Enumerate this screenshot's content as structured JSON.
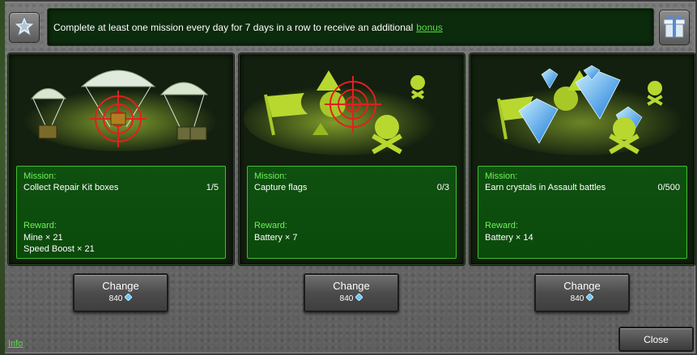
{
  "header": {
    "message": "Complete at least one mission every day for 7 days in a row to receive an additional",
    "bonus_link": "bonus",
    "star_icon": "star-icon",
    "gift_icon": "gift-icon"
  },
  "missions": [
    {
      "mission_label": "Mission:",
      "task": "Collect Repair Kit boxes",
      "progress": "1/5",
      "reward_label": "Reward:",
      "rewards": [
        "Mine × 21",
        "Speed Boost × 21"
      ],
      "change_label": "Change",
      "price": "840",
      "art_icon": "parachute-crates-target-icon"
    },
    {
      "mission_label": "Mission:",
      "task": "Capture flags",
      "progress": "0/3",
      "reward_label": "Reward:",
      "rewards": [
        "Battery × 7"
      ],
      "change_label": "Change",
      "price": "840",
      "art_icon": "flag-target-skull-icon"
    },
    {
      "mission_label": "Mission:",
      "task": "Earn crystals in Assault battles",
      "progress": "0/500",
      "reward_label": "Reward:",
      "rewards": [
        "Battery × 14"
      ],
      "change_label": "Change",
      "price": "840",
      "art_icon": "crystals-flag-skull-icon"
    }
  ],
  "footer": {
    "info_link": "Info",
    "close_label": "Close"
  },
  "colors": {
    "accent_green": "#4fe03c",
    "panel_green": "#0a4a0a",
    "crystal_blue": "#5ab8ff"
  }
}
